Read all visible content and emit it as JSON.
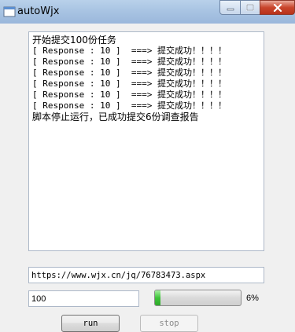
{
  "window": {
    "title": "autoWjx",
    "icon": "app-icon",
    "controls": {
      "minimize_icon": "minimize-icon",
      "maximize_icon": "maximize-icon",
      "close_icon": "close-icon"
    }
  },
  "log": {
    "lines": [
      "开始提交100份任务",
      "[ Response : 10 ]  ===> 提交成功！！！！",
      "[ Response : 10 ]  ===> 提交成功！！！！",
      "[ Response : 10 ]  ===> 提交成功！！！！",
      "[ Response : 10 ]  ===> 提交成功！！！！",
      "[ Response : 10 ]  ===> 提交成功！！！！",
      "[ Response : 10 ]  ===> 提交成功！！！！",
      "脚本停止运行，已成功提交6份调查报告"
    ]
  },
  "form": {
    "url_value": "https://www.wjx.cn/jq/76783473.aspx",
    "count_value": "100"
  },
  "progress": {
    "value": 0.06,
    "label": "6%",
    "fill_color": "#3fc43a"
  },
  "buttons": {
    "run_label": "run",
    "stop_label": "stop"
  }
}
